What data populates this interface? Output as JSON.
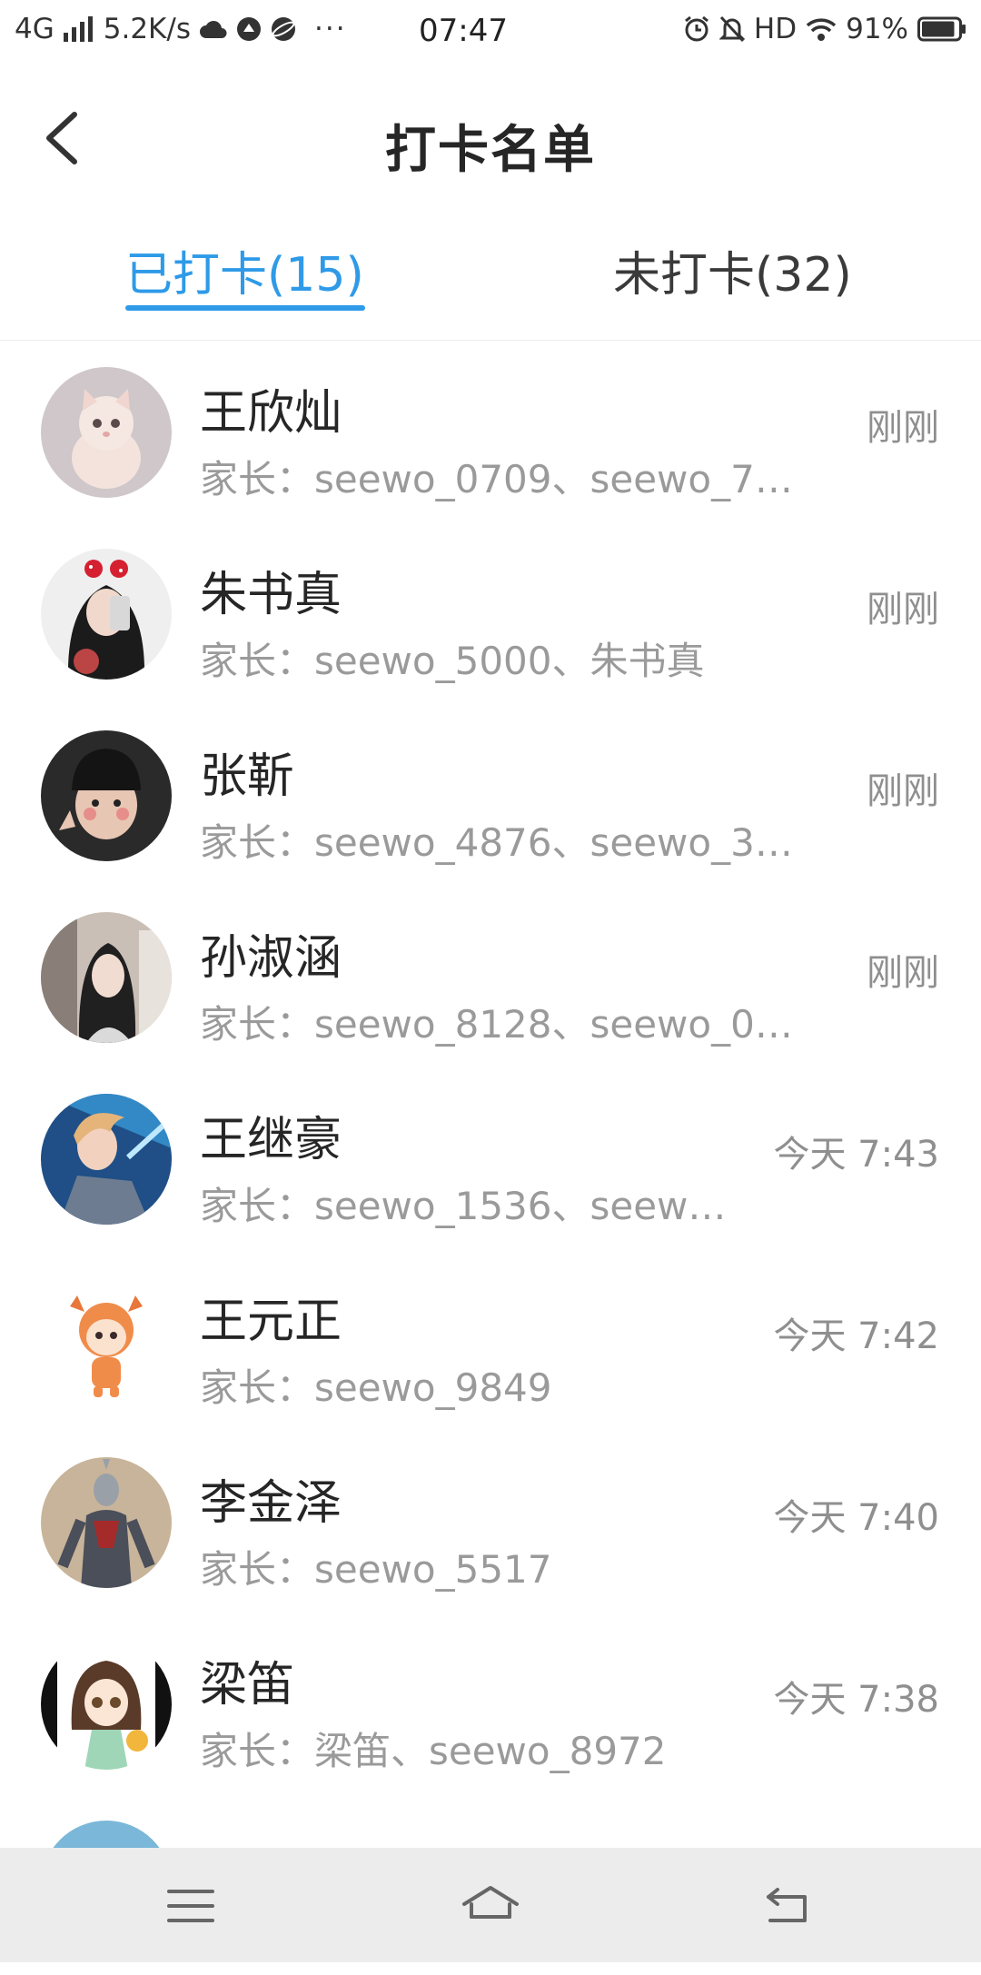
{
  "status_bar": {
    "network": "4G",
    "speed": "5.2K/s",
    "more": "···",
    "time": "07:47",
    "hd": "HD",
    "battery": "91%",
    "battery_level": 0.91
  },
  "header": {
    "title": "打卡名单"
  },
  "tabs": [
    {
      "label": "已打卡(15)",
      "active": true
    },
    {
      "label": "未打卡(32)",
      "active": false
    }
  ],
  "colors": {
    "accent": "#2e9ae8",
    "muted": "#9a9a9a"
  },
  "students": [
    {
      "name": "王欣灿",
      "parents": "家长：seewo_0709、seewo_7…",
      "time": "刚刚",
      "avatar": "kitten-photo"
    },
    {
      "name": "朱书真",
      "parents": "家长：seewo_5000、朱书真",
      "time": "刚刚",
      "avatar": "girl-selfie-photo"
    },
    {
      "name": "张靳",
      "parents": "家长：seewo_4876、seewo_3…",
      "time": "刚刚",
      "avatar": "child-beanie-photo"
    },
    {
      "name": "孙淑涵",
      "parents": "家长：seewo_8128、seewo_0…",
      "time": "刚刚",
      "avatar": "girl-portrait-photo"
    },
    {
      "name": "王继豪",
      "parents": "家长：seewo_1536、seew…",
      "time": "今天 7:43",
      "avatar": "game-hero-art"
    },
    {
      "name": "王元正",
      "parents": "家长：seewo_9849",
      "time": "今天 7:42",
      "avatar": "deer-cartoon"
    },
    {
      "name": "李金泽",
      "parents": "家长：seewo_5517",
      "time": "今天 7:40",
      "avatar": "ultraman-figure"
    },
    {
      "name": "梁笛",
      "parents": "家长：梁笛、seewo_8972",
      "time": "今天 7:38",
      "avatar": "anime-girl-art"
    }
  ]
}
